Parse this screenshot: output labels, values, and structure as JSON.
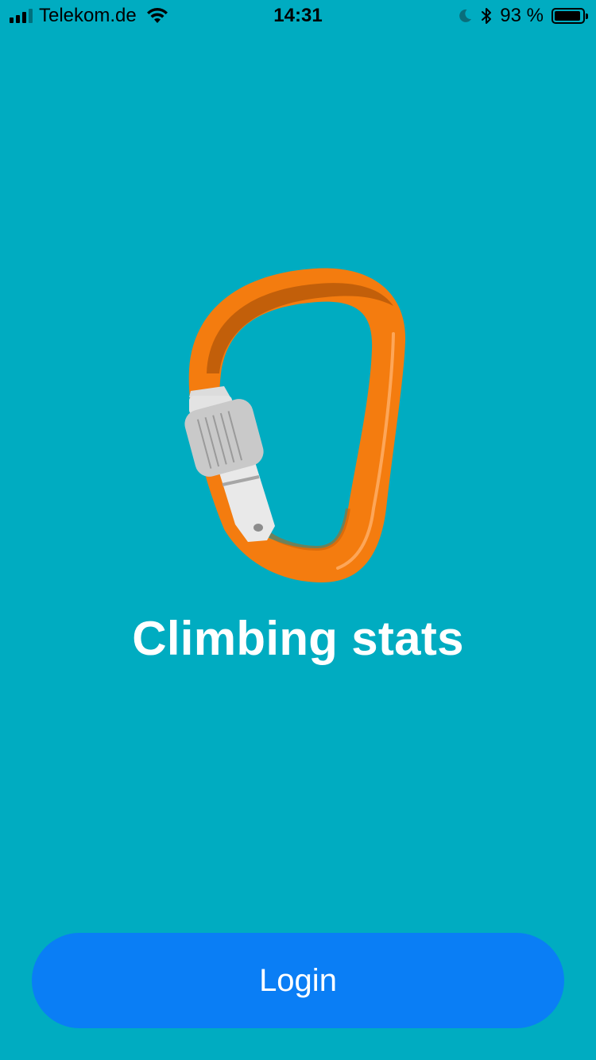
{
  "status_bar": {
    "carrier": "Telekom.de",
    "time": "14:31",
    "battery": "93 %",
    "battery_level": 0.93,
    "icons": [
      "signal-icon",
      "wifi-icon",
      "moon-icon",
      "bluetooth-icon",
      "battery-icon"
    ]
  },
  "app": {
    "logo_icon": "carabiner-icon",
    "title": "Climbing stats"
  },
  "actions": {
    "login_label": "Login"
  },
  "colors": {
    "background": "#00acc1",
    "primary_button": "#0a7ef5",
    "carabiner_orange": "#f47c0f",
    "gate_silver": "#c8c8c8"
  }
}
